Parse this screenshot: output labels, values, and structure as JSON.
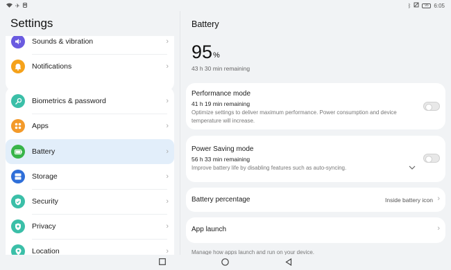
{
  "statusbar": {
    "left_icons": [
      "wifi-icon",
      "airplane-icon",
      "notification-icon"
    ],
    "time": "6:05",
    "battery_level": "95"
  },
  "sidebar": {
    "title": "Settings",
    "group1": [
      {
        "label": "Sounds & vibration",
        "icon": "speaker-icon",
        "color": "#6a5be0"
      },
      {
        "label": "Notifications",
        "icon": "bell-icon",
        "color": "#f5a21b"
      }
    ],
    "group2": [
      {
        "label": "Biometrics & password",
        "icon": "key-icon",
        "color": "#3bbfa8"
      },
      {
        "label": "Apps",
        "icon": "apps-grid-icon",
        "color": "#f39a2a"
      },
      {
        "label": "Battery",
        "icon": "battery-icon",
        "color": "#39b54a",
        "selected": true
      },
      {
        "label": "Storage",
        "icon": "storage-icon",
        "color": "#2f6fd9"
      },
      {
        "label": "Security",
        "icon": "shield-icon",
        "color": "#3bbfa8"
      },
      {
        "label": "Privacy",
        "icon": "privacy-icon",
        "color": "#3bbfa8"
      },
      {
        "label": "Location",
        "icon": "location-pin-icon",
        "color": "#3bbfa8"
      }
    ]
  },
  "battery": {
    "title": "Battery",
    "percent": "95",
    "percent_unit": "%",
    "remaining": "43 h 30 min remaining",
    "performance": {
      "title": "Performance mode",
      "sub": "41 h 19 min remaining",
      "desc": "Optimize settings to deliver maximum performance. Power consumption and device temperature will increase.",
      "enabled": false
    },
    "power_saving": {
      "title": "Power Saving mode",
      "sub": "56 h 33 min remaining",
      "desc": "Improve battery life by disabling features such as auto-syncing.",
      "enabled": false
    },
    "percentage": {
      "title": "Battery percentage",
      "value": "Inside battery icon"
    },
    "app_launch": {
      "title": "App launch"
    },
    "manage_text": "Manage how apps launch and run on your device."
  },
  "colors": {
    "selected_bg": "#e2eefa",
    "page_bg": "#f1f3f5"
  }
}
